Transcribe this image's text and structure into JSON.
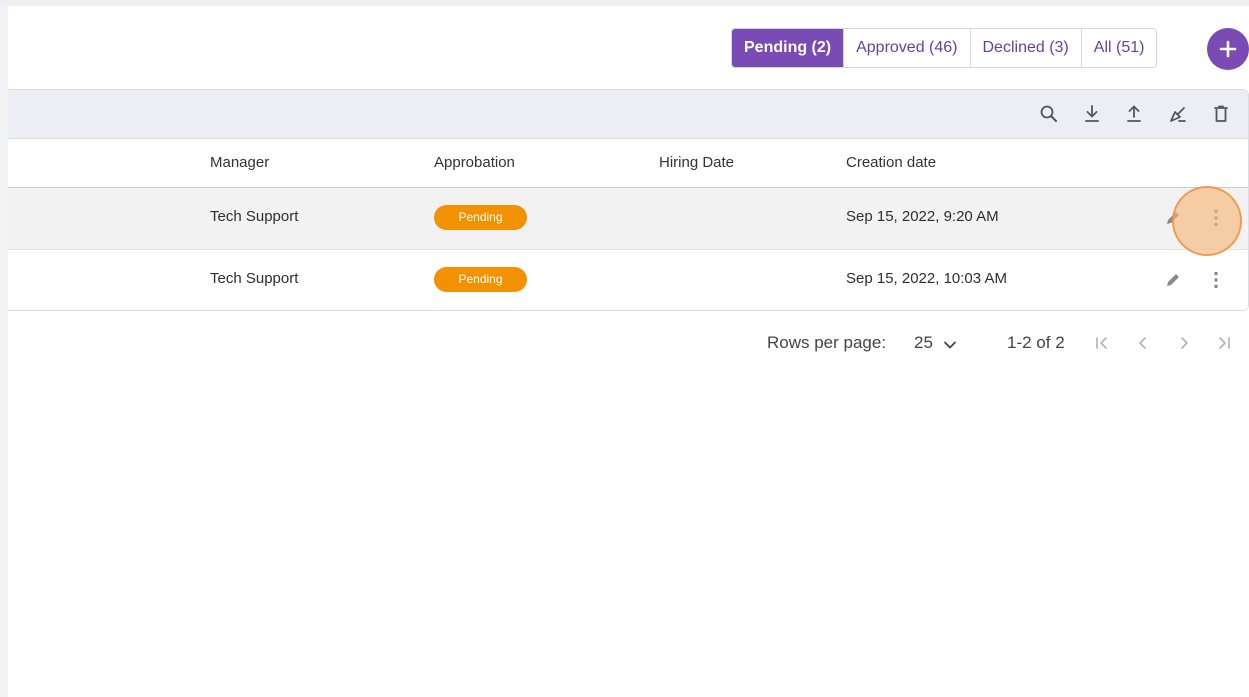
{
  "filters": [
    {
      "label": "Pending (2)",
      "active": true
    },
    {
      "label": "Approved (46)",
      "active": false
    },
    {
      "label": "Declined (3)",
      "active": false
    },
    {
      "label": "All (51)",
      "active": false
    }
  ],
  "add_button": {
    "icon": "plus-icon"
  },
  "toolbar": {
    "icons": [
      "search-icon",
      "download-icon",
      "upload-icon",
      "clear-filter-icon",
      "trash-icon"
    ]
  },
  "table": {
    "columns": [
      "Manager",
      "Approbation",
      "Hiring Date",
      "Creation date"
    ],
    "rows": [
      {
        "manager": "Tech Support",
        "approbation": "Pending",
        "hiring_date": "",
        "creation_date": "Sep 15, 2022, 9:20 AM"
      },
      {
        "manager": "Tech Support",
        "approbation": "Pending",
        "hiring_date": "",
        "creation_date": "Sep 15, 2022, 10:03 AM"
      }
    ]
  },
  "pagination": {
    "rows_per_page_label": "Rows per page:",
    "rows_per_page_value": "25",
    "range_text": "1-2 of 2"
  },
  "colors": {
    "accent": "#7a4bb5",
    "pending_badge": "#f39200",
    "highlight": "#f7b676"
  }
}
